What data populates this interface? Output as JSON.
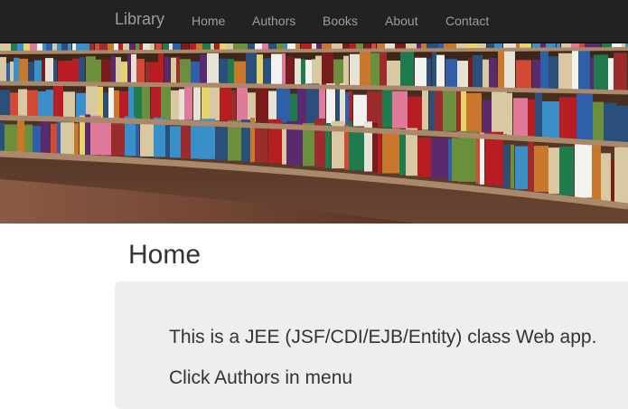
{
  "navbar": {
    "brand": "Library",
    "items": [
      {
        "label": "Home"
      },
      {
        "label": "Authors"
      },
      {
        "label": "Books"
      },
      {
        "label": "About"
      },
      {
        "label": "Contact"
      }
    ],
    "colors": {
      "background": "#222222",
      "text": "#9d9d9d"
    }
  },
  "hero": {
    "image": "library-bookshelves"
  },
  "main": {
    "title": "Home",
    "jumbotron": {
      "line1": "This is a JEE (JSF/CDI/EJB/Entity) class Web app.",
      "line2": "Click Authors in menu"
    }
  }
}
